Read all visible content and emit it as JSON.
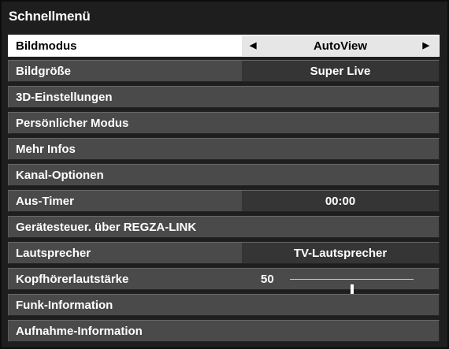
{
  "menu": {
    "title": "Schnellmenü",
    "rows": [
      {
        "label": "Bildmodus",
        "value": "AutoView",
        "selected": true
      },
      {
        "label": "Bildgröße",
        "value": "Super Live"
      },
      {
        "label": "3D-Einstellungen"
      },
      {
        "label": "Persönlicher Modus"
      },
      {
        "label": "Mehr Infos"
      },
      {
        "label": "Kanal-Optionen"
      },
      {
        "label": "Aus-Timer",
        "value": "00:00"
      },
      {
        "label": "Gerätesteuer. über REGZA-LINK"
      },
      {
        "label": "Lautsprecher",
        "value": "TV-Lautsprecher"
      },
      {
        "label": "Kopfhörerlautstärke",
        "value": "50",
        "level_percent": 50
      },
      {
        "label": "Funk-Information"
      },
      {
        "label": "Aufnahme-Information"
      }
    ]
  },
  "icons": {
    "left": "arrow-left-icon",
    "right": "arrow-right-icon"
  }
}
